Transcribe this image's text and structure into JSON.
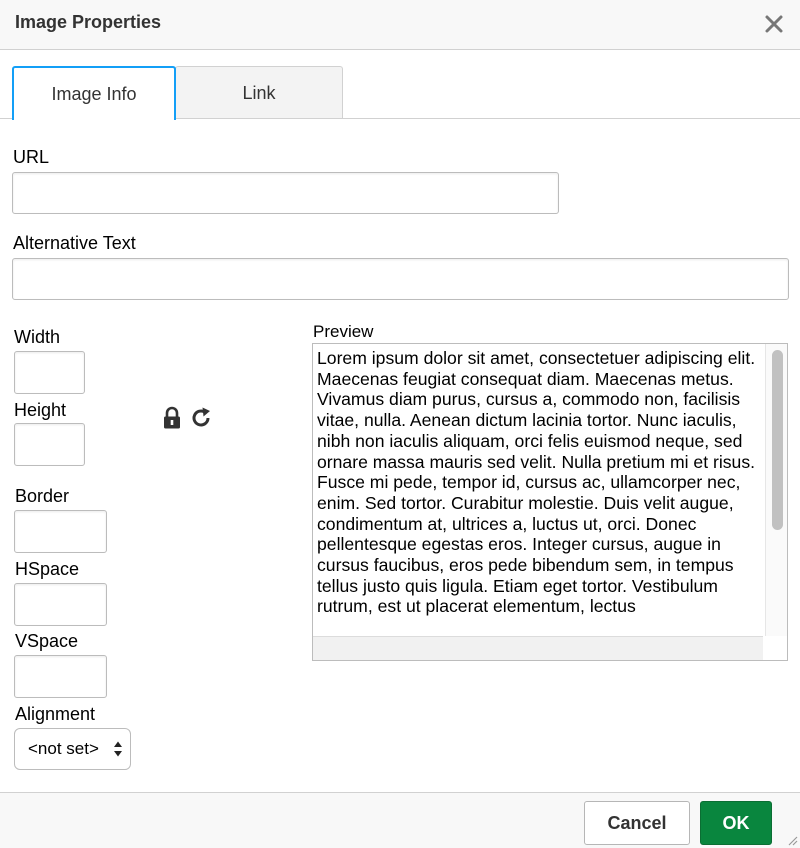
{
  "dialog": {
    "title": "Image Properties",
    "close_icon": "close-icon"
  },
  "tabs": [
    {
      "label": "Image Info",
      "active": true
    },
    {
      "label": "Link",
      "active": false
    }
  ],
  "fields": {
    "url_label": "URL",
    "url_value": "",
    "alt_label": "Alternative Text",
    "alt_value": "",
    "width_label": "Width",
    "width_value": "",
    "height_label": "Height",
    "height_value": "",
    "border_label": "Border",
    "border_value": "",
    "hspace_label": "HSpace",
    "hspace_value": "",
    "vspace_label": "VSpace",
    "vspace_value": "",
    "alignment_label": "Alignment",
    "alignment_value": "<not set>"
  },
  "icons": {
    "lock": "lock-icon",
    "reset": "refresh-icon",
    "select_arrows": "updown-arrows-icon"
  },
  "preview": {
    "label": "Preview",
    "text": "Lorem ipsum dolor sit amet, consectetuer adipiscing elit. Maecenas feugiat consequat diam. Maecenas metus. Vivamus diam purus, cursus a, commodo non, facilisis vitae, nulla. Aenean dictum lacinia tortor. Nunc iaculis, nibh non iaculis aliquam, orci felis euismod neque, sed ornare massa mauris sed velit. Nulla pretium mi et risus. Fusce mi pede, tempor id, cursus ac, ullamcorper nec, enim. Sed tortor. Curabitur molestie. Duis velit augue, condimentum at, ultrices a, luctus ut, orci. Donec pellentesque egestas eros. Integer cursus, augue in cursus faucibus, eros pede bibendum sem, in tempus tellus justo quis ligula. Etiam eget tortor. Vestibulum rutrum, est ut placerat elementum, lectus"
  },
  "footer": {
    "cancel_label": "Cancel",
    "ok_label": "OK"
  },
  "colors": {
    "accent": "#139ff7",
    "ok_green": "#09863e"
  }
}
